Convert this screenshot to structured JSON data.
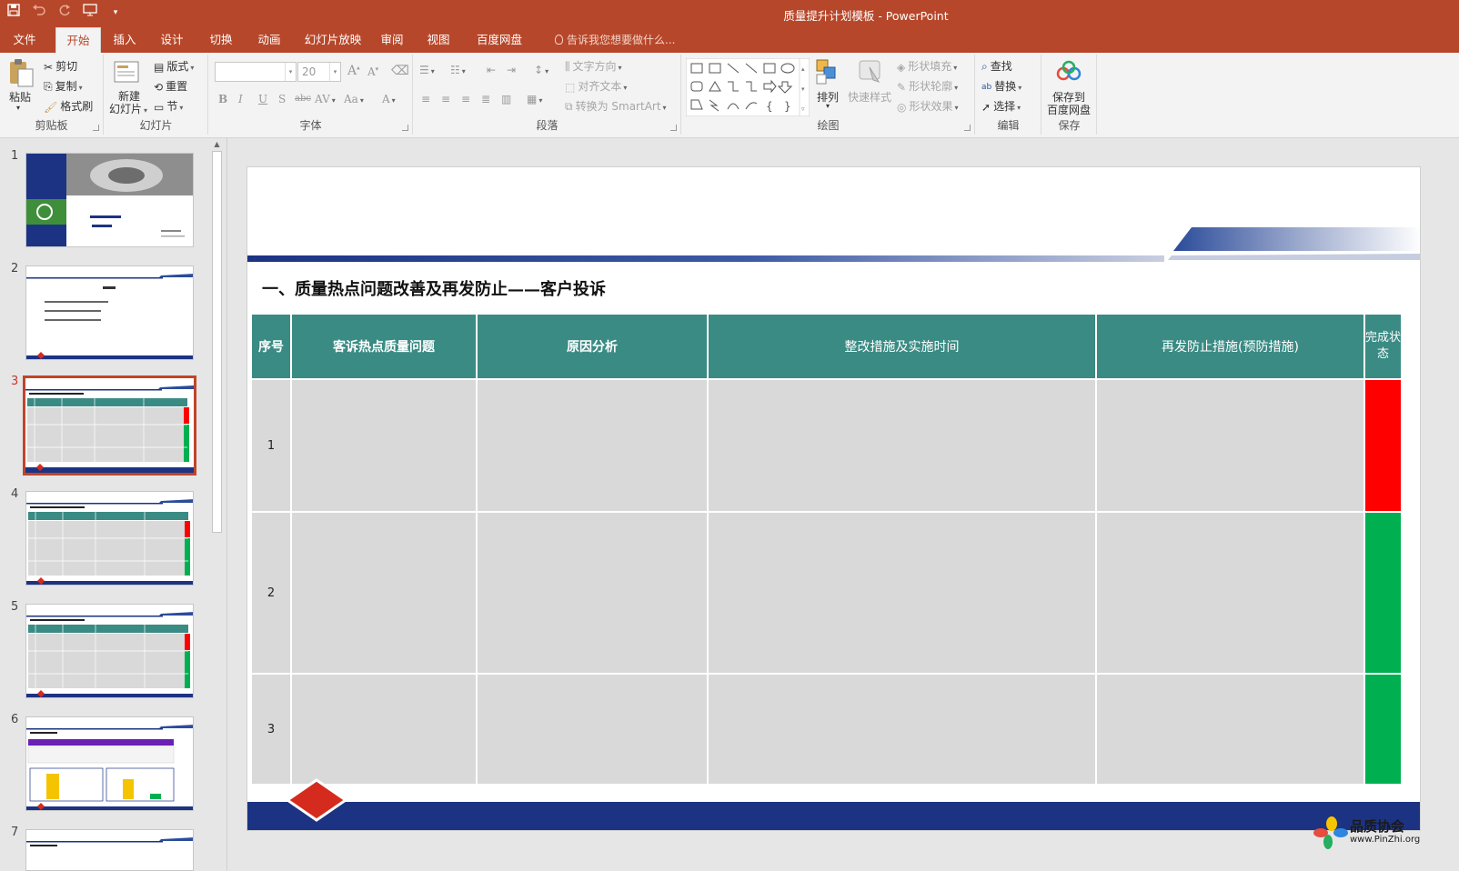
{
  "titlebar": {
    "title": "质量提升计划模板 - PowerPoint",
    "qat_icons": [
      "save-icon",
      "undo-icon",
      "redo-icon",
      "start-from-beginning-icon",
      "customize-qat-icon"
    ]
  },
  "ribbon_tabs": {
    "file": "文件",
    "home": "开始",
    "insert": "插入",
    "design": "设计",
    "transitions": "切换",
    "animations": "动画",
    "slideshow": "幻灯片放映",
    "review": "审阅",
    "view": "视图",
    "baidu": "百度网盘",
    "active": "开始",
    "tell_me": "告诉我您想要做什么..."
  },
  "clipboard": {
    "paste": "粘贴",
    "cut": "剪切",
    "copy": "复制",
    "format_painter": "格式刷",
    "label": "剪贴板"
  },
  "slides_group": {
    "new_slide_line1": "新建",
    "new_slide_line2": "幻灯片",
    "layout": "版式",
    "reset": "重置",
    "section": "节",
    "label": "幻灯片"
  },
  "font_group": {
    "font_name": "",
    "font_size": "20",
    "bold": "B",
    "italic": "I",
    "underline": "U",
    "shadow": "S",
    "strike": "abc",
    "spacing": "AV",
    "change_case": "Aa",
    "grow": "A",
    "shrink": "A",
    "font_color": "A",
    "label": "字体"
  },
  "paragraph_group": {
    "text_direction": "文字方向",
    "align_text": "对齐文本",
    "smartart": "转换为 SmartArt",
    "label": "段落"
  },
  "drawing_group": {
    "arrange": "排列",
    "quick_styles": "快速样式",
    "shape_fill": "形状填充",
    "shape_outline": "形状轮廓",
    "shape_effects": "形状效果",
    "label": "绘图"
  },
  "editing_group": {
    "find": "查找",
    "replace": "替换",
    "select": "选择",
    "label": "编辑"
  },
  "save_group": {
    "save_line1": "保存到",
    "save_line2": "百度网盘",
    "label": "保存"
  },
  "thumbnails": {
    "numbers": [
      "1",
      "2",
      "3",
      "4",
      "5",
      "6",
      "7"
    ],
    "selected": "3"
  },
  "slide": {
    "title": "一、质量热点问题改善及再发防止——客户投诉",
    "headers": [
      "序号",
      "客诉热点质量问题",
      "原因分析",
      "整改措施及实施时间",
      "再发防止措施(预防措施)",
      "完成状态"
    ],
    "rows": [
      {
        "no": "1",
        "status_color": "#ff0000"
      },
      {
        "no": "2",
        "status_color": "#00b050"
      },
      {
        "no": "3",
        "status_color": "#00b050"
      }
    ],
    "colors": {
      "header": "#3a8b84",
      "band": "#1c3383",
      "diamond": "#d52b1e",
      "cell": "#d9d9d9"
    }
  },
  "watermark": {
    "line1": "品质协会",
    "line2": "www.PinZhi.org"
  }
}
